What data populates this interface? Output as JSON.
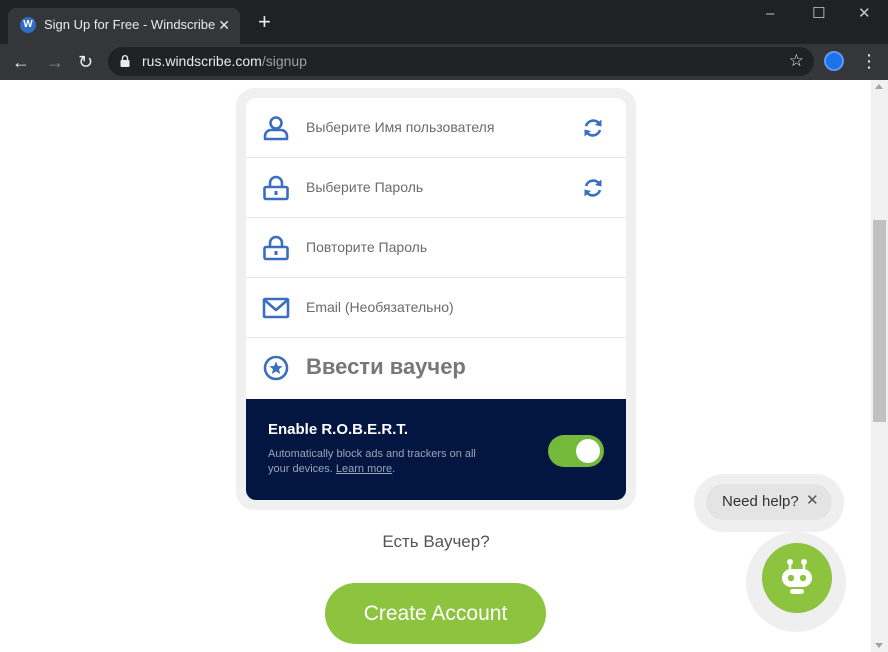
{
  "browser": {
    "tab_title": "Sign Up for Free - Windscribe",
    "tab_favicon_letter": "W",
    "tab_close": "✕",
    "new_tab": "+",
    "url_host": "rus.windscribe.com",
    "url_path": "/signup",
    "window_controls": {
      "minimize": "–",
      "maximize": "☐",
      "close": "✕"
    },
    "nav": {
      "back": "←",
      "forward": "→",
      "reload": "↻"
    },
    "bookmark_icon": "☆",
    "menu_icon": "⋮"
  },
  "form": {
    "fields": [
      {
        "label": "Выберите Имя пользователя",
        "icon": "user-icon",
        "refresh": true
      },
      {
        "label": "Выберите Пароль",
        "icon": "lock-icon",
        "refresh": true
      },
      {
        "label": "Повторите Пароль",
        "icon": "lock-icon",
        "refresh": false
      },
      {
        "label": "Email (Необязательно)",
        "icon": "mail-icon",
        "refresh": false
      }
    ],
    "voucher_label": "Ввести ваучер",
    "voucher_icon": "star-circle-icon"
  },
  "robert": {
    "title": "Enable R.O.B.E.R.T.",
    "description": "Automatically block ads and trackers on all your devices.",
    "learn_more": "Learn more",
    "trailing": ".",
    "enabled": true
  },
  "voucher_question": "Есть Ваучер?",
  "create_button": "Create Account",
  "help": {
    "text": "Need help?",
    "close": "✕"
  },
  "colors": {
    "brand_green": "#8cc43f",
    "brand_navy": "#031642",
    "icon_blue": "#3a6fbf"
  }
}
